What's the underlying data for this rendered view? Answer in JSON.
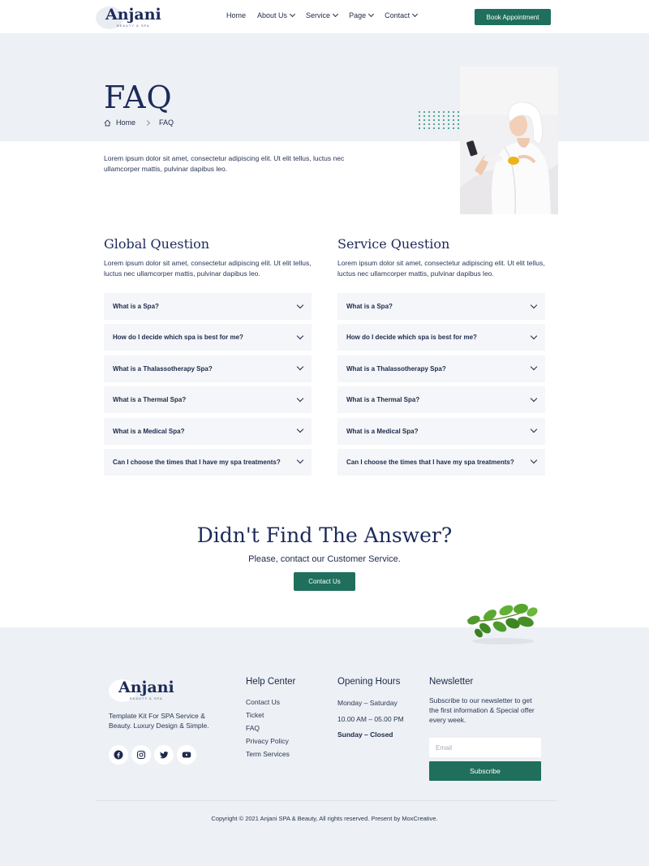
{
  "header": {
    "logo": {
      "name": "Anjani",
      "sub": "BEAUTY & SPA"
    },
    "nav": [
      {
        "label": "Home",
        "dropdown": false
      },
      {
        "label": "About Us",
        "dropdown": true
      },
      {
        "label": "Service",
        "dropdown": true
      },
      {
        "label": "Page",
        "dropdown": true
      },
      {
        "label": "Contact",
        "dropdown": true
      }
    ],
    "book_label": "Book Appointment"
  },
  "hero": {
    "title": "FAQ",
    "breadcrumb": {
      "home": "Home",
      "current": "FAQ"
    },
    "description": "Lorem ipsum dolor sit amet, consectetur adipiscing elit. Ut elit tellus, luctus nec ullamcorper mattis, pulvinar dapibus leo."
  },
  "faq": {
    "global": {
      "title": "Global Question",
      "description": "Lorem ipsum dolor sit amet, consectetur adipiscing elit. Ut elit tellus, luctus nec ullamcorper mattis, pulvinar dapibus leo.",
      "items": [
        "What is a Spa?",
        "How do I decide which spa is best for me?",
        "What is a Thalassotherapy Spa?",
        "What is a Thermal Spa?",
        "What is a Medical Spa?",
        "Can I choose the times that I have my spa treatments?"
      ]
    },
    "service": {
      "title": "Service Question",
      "description": "Lorem ipsum dolor sit amet, consectetur adipiscing elit. Ut elit tellus, luctus nec ullamcorper mattis, pulvinar dapibus leo.",
      "items": [
        "What is a Spa?",
        "How do I decide which spa is best for me?",
        "What is a Thalassotherapy Spa?",
        "What is a Thermal Spa?",
        "What is a Medical Spa?",
        "Can I choose the times that I have my spa treatments?"
      ]
    }
  },
  "cta": {
    "title": "Didn't Find The Answer?",
    "subtitle": "Please, contact our Customer Service.",
    "button": "Contact Us"
  },
  "footer": {
    "logo": {
      "name": "Anjani",
      "sub": "BEAUTY & SPA"
    },
    "tagline": "Template Kit For SPA Service & Beauty. Luxury Design & Simple.",
    "socials": [
      "facebook-icon",
      "instagram-icon",
      "twitter-icon",
      "youtube-icon"
    ],
    "help": {
      "title": "Help Center",
      "links": [
        "Contact Us",
        "Ticket",
        "FAQ",
        "Privacy Policy",
        "Term Services"
      ]
    },
    "hours": {
      "title": "Opening Hours",
      "days": "Monday – Saturday",
      "time": "10.00 AM – 05.00 PM",
      "closed": "Sunday – Closed"
    },
    "newsletter": {
      "title": "Newsletter",
      "description": "Subscribe to our newsletter to get the first information & Special offer every week.",
      "placeholder": "Email",
      "button": "Subscribe"
    },
    "copyright": "Copyright © 2021 Anjani SPA & Beauty, All rights reserved. Present by MoxCreative."
  },
  "colors": {
    "accent": "#1f6f5c",
    "navy": "#1c2a5a",
    "panel": "#edf0f4"
  }
}
